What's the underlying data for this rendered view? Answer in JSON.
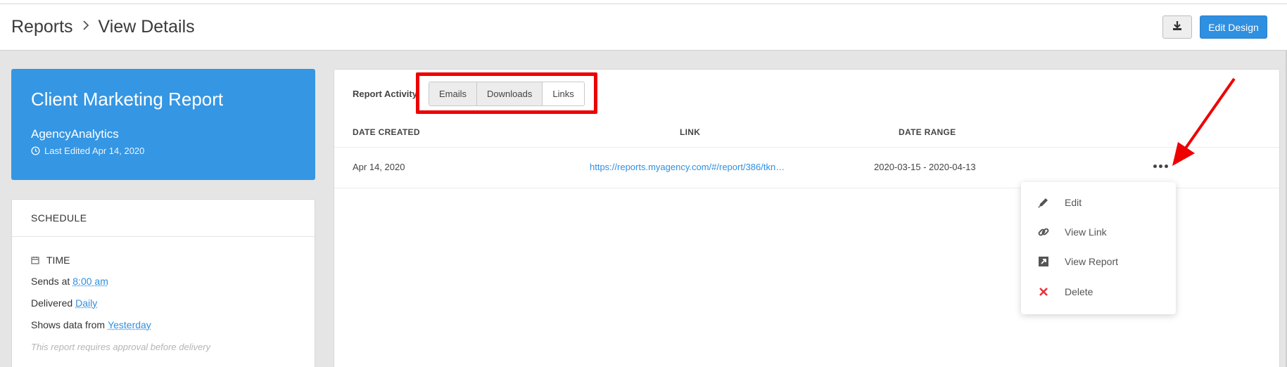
{
  "header": {
    "breadcrumb": [
      "Reports",
      "View Details"
    ],
    "download_icon": "download-icon",
    "edit_design_label": "Edit Design"
  },
  "report_card": {
    "title": "Client Marketing Report",
    "agency": "AgencyAnalytics",
    "last_edited": "Last Edited Apr 14, 2020"
  },
  "schedule": {
    "heading": "SCHEDULE",
    "time_label": "TIME",
    "sends_at_prefix": "Sends at",
    "sends_at_value": "8:00 am",
    "delivered_prefix": "Delivered",
    "delivered_value": "Daily",
    "shows_data_prefix": "Shows data from",
    "shows_data_value": "Yesterday",
    "note": "This report requires approval before delivery"
  },
  "activity": {
    "label": "Report Activity",
    "tabs": [
      "Emails",
      "Downloads",
      "Links"
    ],
    "active_tab": "Links",
    "columns": [
      "DATE CREATED",
      "LINK",
      "DATE RANGE"
    ],
    "rows": [
      {
        "date_created": "Apr 14, 2020",
        "link": "https://reports.myagency.com/#/report/386/tkn…",
        "date_range": "2020-03-15 - 2020-04-13"
      }
    ]
  },
  "menu": {
    "items": [
      {
        "label": "Edit",
        "icon": "pencil-icon"
      },
      {
        "label": "View Link",
        "icon": "link-icon"
      },
      {
        "label": "View Report",
        "icon": "external-link-icon"
      },
      {
        "label": "Delete",
        "icon": "close-icon"
      }
    ]
  },
  "colors": {
    "accent": "#2f8fe0",
    "card_blue": "#3596e3",
    "highlight_red": "#ee0000",
    "delete_red": "#e8323c"
  }
}
